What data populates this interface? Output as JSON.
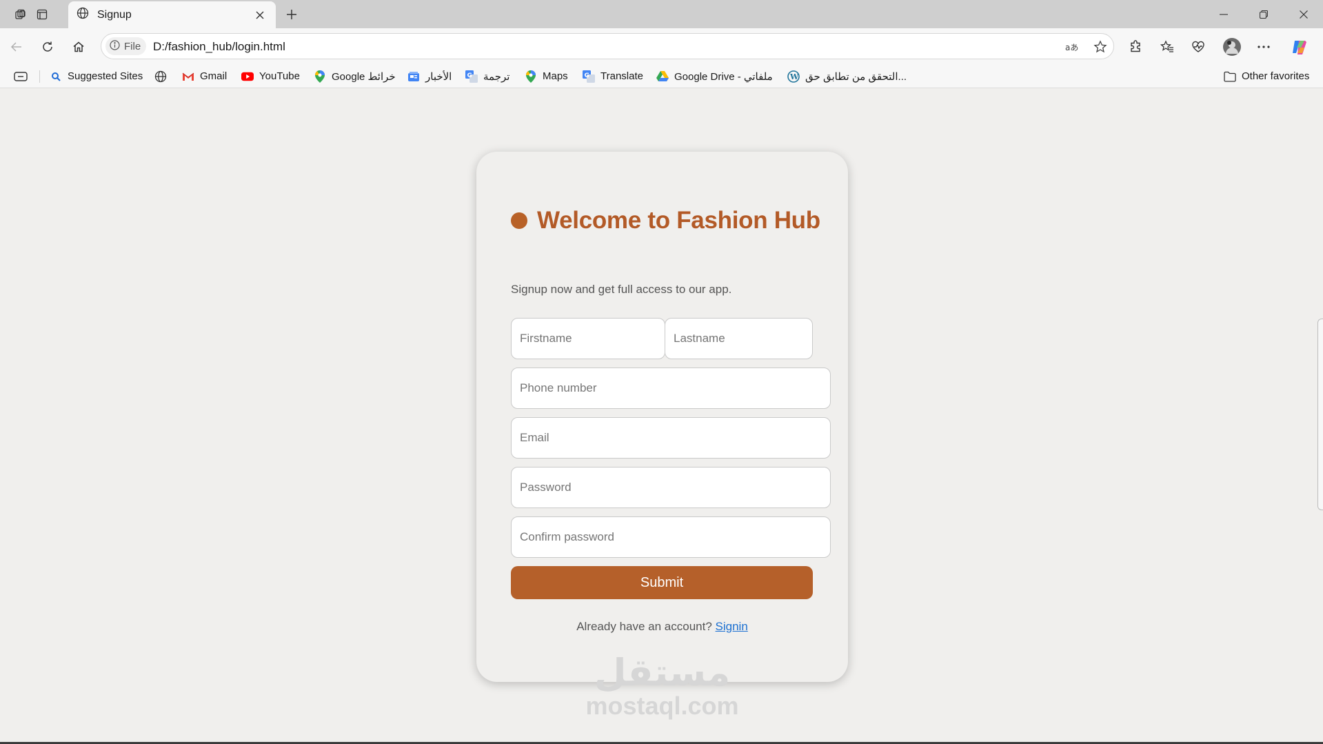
{
  "browser": {
    "tab": {
      "title": "Signup",
      "favicon": "globe-icon"
    },
    "url": "D:/fashion_hub/login.html",
    "site_chip": "File",
    "omnibox_icons": [
      "read-aloud-icon",
      "favorite-star-icon"
    ],
    "toolbar_icons": [
      "extensions-icon",
      "favorites-icon",
      "browser-essentials-icon",
      "profile-avatar",
      "more-icon",
      "copilot-icon"
    ],
    "bookmarks": [
      {
        "label": "Suggested Sites",
        "icon": "search-icon"
      },
      {
        "label": "",
        "icon": "globe-icon"
      },
      {
        "label": "Gmail",
        "icon": "gmail-icon"
      },
      {
        "label": "YouTube",
        "icon": "youtube-icon"
      },
      {
        "label": "Google خرائط",
        "icon": "maps-pin-icon"
      },
      {
        "label": "الأخبار",
        "icon": "news-icon"
      },
      {
        "label": "ترجمة",
        "icon": "translate-icon"
      },
      {
        "label": "Maps",
        "icon": "maps-pin-icon"
      },
      {
        "label": "Translate",
        "icon": "translate-icon"
      },
      {
        "label": "Google Drive - ملفاتي",
        "icon": "drive-icon"
      },
      {
        "label": "التحقق من تطابق حق...",
        "icon": "wordpress-icon"
      }
    ],
    "other_favorites": "Other favorites"
  },
  "signup": {
    "title": "Welcome to Fashion Hub",
    "subtitle": "Signup now and get full access to our app.",
    "fields": {
      "firstname": "Firstname",
      "lastname": "Lastname",
      "phone": "Phone number",
      "email": "Email",
      "password": "Password",
      "confirm_password": "Confirm password"
    },
    "submit_label": "Submit",
    "signin_prompt": "Already have an account?",
    "signin_link": "Signin"
  },
  "watermark": {
    "arabic": "مستقل",
    "latin": "mostaql.com"
  },
  "colors": {
    "accent": "#b5602a",
    "title": "#b35a27",
    "link": "#1a6fd1",
    "page_bg": "#f0efed"
  }
}
